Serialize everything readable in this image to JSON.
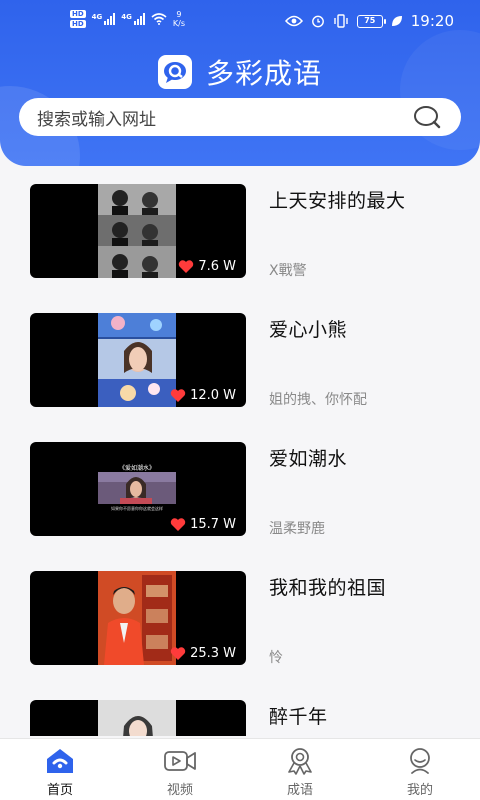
{
  "status_bar": {
    "hd_top": "HD",
    "hd_bottom": "HD",
    "network1": "4G",
    "network2": "4G",
    "speed_value": "9",
    "speed_unit": "K/s",
    "battery": "75",
    "time": "19:20"
  },
  "header": {
    "app_title": "多彩成语",
    "logo_icon": "chat-bubble-logo-icon"
  },
  "search": {
    "placeholder": "搜索或输入网址",
    "icon": "search-icon"
  },
  "videos": [
    {
      "title": "上天安排的最大",
      "author": "X戰警",
      "likes": "7.6 W"
    },
    {
      "title": "爱心小熊",
      "author": "姐的拽、你怀配",
      "likes": "12.0 W"
    },
    {
      "title": "爱如潮水",
      "author": "温柔野鹿",
      "likes": "15.7 W",
      "overlay_title": "《爱如潮水》",
      "overlay_caption": "如果你不愿意你你这就会这样"
    },
    {
      "title": "我和我的祖国",
      "author": "怜",
      "likes": "25.3 W"
    },
    {
      "title": "醉千年",
      "author": "",
      "likes": ""
    }
  ],
  "tabs": [
    {
      "label": "首页",
      "icon": "home-icon",
      "active": true
    },
    {
      "label": "视频",
      "icon": "video-camera-icon",
      "active": false
    },
    {
      "label": "成语",
      "icon": "badge-icon",
      "active": false
    },
    {
      "label": "我的",
      "icon": "user-icon",
      "active": false
    }
  ],
  "colors": {
    "brand_blue": "#2f63ec",
    "heart_red": "#ff3b3b"
  }
}
